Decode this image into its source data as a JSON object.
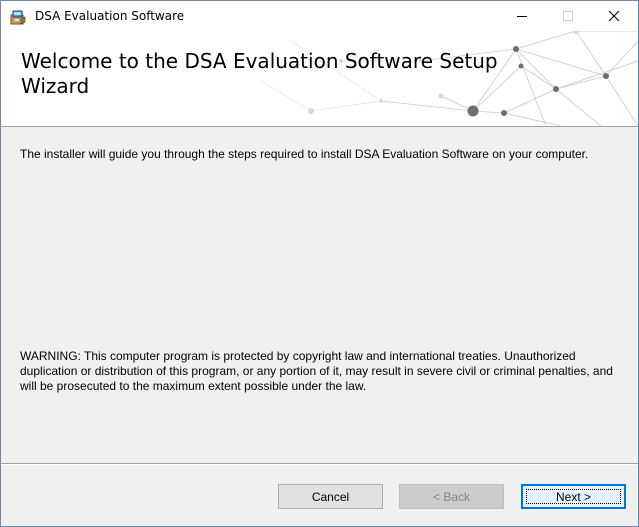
{
  "window": {
    "title": "DSA Evaluation Software",
    "controls": [
      "minimize",
      "maximize",
      "close"
    ]
  },
  "banner": {
    "title": "Welcome to the DSA Evaluation Software Setup Wizard"
  },
  "body": {
    "intro": "The installer will guide you through the steps required to install DSA Evaluation Software on your computer.",
    "warning": "WARNING: This computer program is protected by copyright law and international treaties. Unauthorized duplication or distribution of this program, or any portion of it, may result in severe civil or criminal penalties, and will be prosecuted to the maximum extent possible under the law."
  },
  "buttons": {
    "cancel": "Cancel",
    "back": "< Back",
    "next": "Next >"
  },
  "colors": {
    "accent": "#0078d7",
    "dialog_bg": "#f0f0f0",
    "disabled_text": "#838383"
  },
  "icons": {
    "app": "installer-package-icon",
    "minimize": "minimize-icon",
    "maximize": "maximize-icon",
    "close": "close-icon"
  }
}
